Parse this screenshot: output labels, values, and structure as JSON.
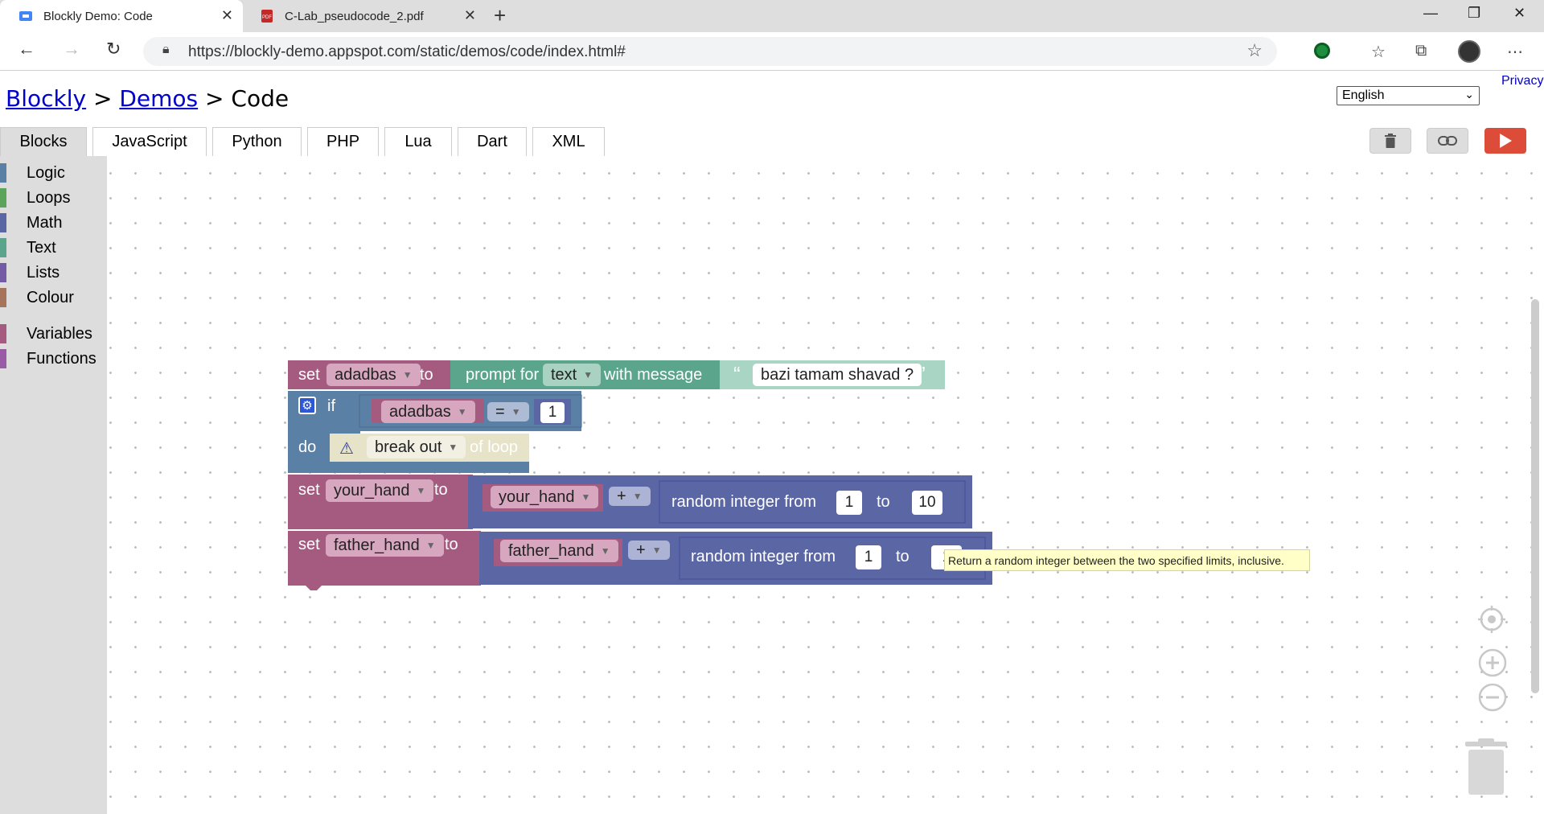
{
  "browser": {
    "tabs": [
      {
        "title": "Blockly Demo: Code",
        "active": true
      },
      {
        "title": "C-Lab_pseudocode_2.pdf",
        "active": false
      }
    ],
    "url": "https://blockly-demo.appspot.com/static/demos/code/index.html#"
  },
  "header": {
    "crumb_blockly": "Blockly",
    "crumb_sep1": ">",
    "crumb_demos": "Demos",
    "crumb_sep2": ">",
    "crumb_code": "Code",
    "privacy": "Privacy",
    "language": "English"
  },
  "code_tabs": [
    "Blocks",
    "JavaScript",
    "Python",
    "PHP",
    "Lua",
    "Dart",
    "XML"
  ],
  "toolbox": {
    "categories": [
      {
        "label": "Logic",
        "color": "#5b80a5"
      },
      {
        "label": "Loops",
        "color": "#5ba55b"
      },
      {
        "label": "Math",
        "color": "#5b67a5"
      },
      {
        "label": "Text",
        "color": "#5ba58c"
      },
      {
        "label": "Lists",
        "color": "#745ba5"
      },
      {
        "label": "Colour",
        "color": "#a5745b"
      },
      {
        "label": "Variables",
        "color": "#a55b80"
      },
      {
        "label": "Functions",
        "color": "#995ba5"
      }
    ]
  },
  "blocks": {
    "b1": {
      "set": "set",
      "var": "adadbas",
      "to": "to",
      "prompt_for": "prompt for",
      "type": "text",
      "with_message": "with message",
      "quote_open": "“",
      "message": "bazi tamam shavad ?",
      "quote_close": "”"
    },
    "b2": {
      "if": "if",
      "var": "adadbas",
      "op": "=",
      "value": "1",
      "do": "do",
      "break": "break out",
      "of_loop": "of loop"
    },
    "b3": {
      "set": "set",
      "var": "your_hand",
      "to": "to",
      "operand": "your_hand",
      "op": "+",
      "random": "random integer from",
      "from": "1",
      "to2": "to",
      "upto": "10"
    },
    "b4": {
      "set": "set",
      "var": "father_hand",
      "to": "to",
      "operand": "father_hand",
      "op": "+",
      "random": "random integer from",
      "from": "1",
      "to2": "to",
      "upto": "1"
    }
  },
  "tooltip": "Return a random integer between the two specified limits, inclusive.",
  "colors": {
    "variables": "#a55b80",
    "logic": "#5b80a5",
    "math": "#5b67a5",
    "text": "#5ba58c",
    "loops": "#5ba55b",
    "run": "#dd4b39"
  }
}
